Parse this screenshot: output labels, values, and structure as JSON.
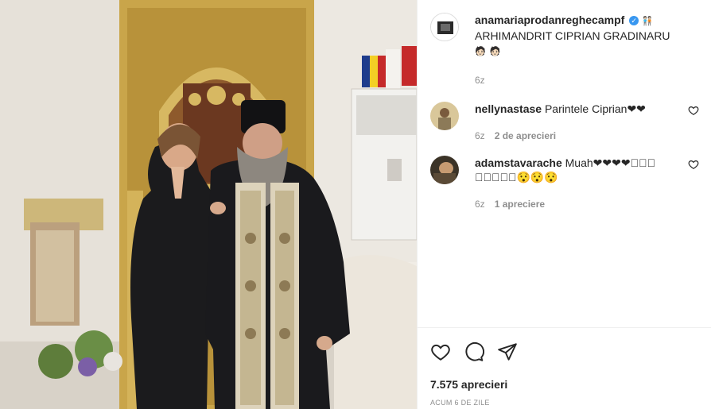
{
  "caption": {
    "username": "anamariaprodanreghecampf",
    "verified_mark": "✓",
    "text_line1": "🧑🏻‍🤝‍🧑🏻",
    "text_main": "ARHIMANDRIT CIPRIAN GRADINARU",
    "text_tail": "🧑🏻 🧑🏻",
    "time": "6z"
  },
  "comments": [
    {
      "username": "nellynastase",
      "text": "Parintele Ciprian❤❤",
      "time": "6z",
      "likes": "2 de aprecieri"
    },
    {
      "username": "adamstavarache",
      "text": "Muah❤❤❤❤􏿽􏿽􏿽 􏿽􏿽􏿽􏿽􏿽😯😯😯",
      "time": "6z",
      "likes": "1 apreciere"
    }
  ],
  "actions": {
    "like_icon": "heart-outline-icon",
    "comment_icon": "comment-bubble-icon",
    "share_icon": "paper-plane-icon"
  },
  "stats": {
    "likes": "7.575 aprecieri",
    "timestamp": "ACUM 6 DE ZILE"
  },
  "colors": {
    "accent": "#3897f0",
    "text": "#262626",
    "muted": "#8e8e8e",
    "heart_red": "#c21a1a"
  }
}
